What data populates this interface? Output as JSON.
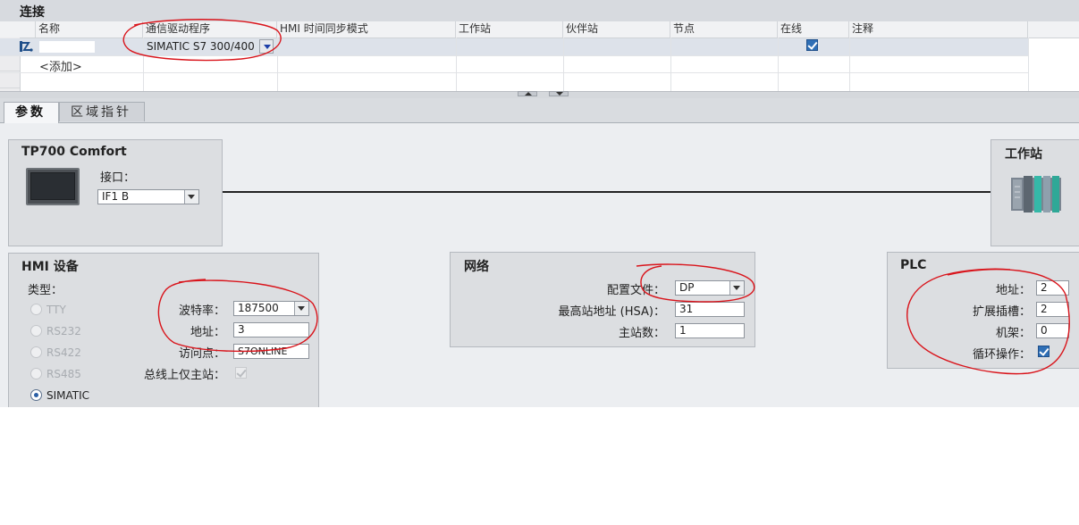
{
  "connections": {
    "title": "连接",
    "columns": [
      "名称",
      "通信驱动程序",
      "HMI 时间同步模式",
      "工作站",
      "伙伴站",
      "节点",
      "在线",
      "注释"
    ],
    "row": {
      "driver": "SIMATIC S7 300/400",
      "online": true
    },
    "add_label": "<添加>"
  },
  "tabs": [
    {
      "label": "参数",
      "active": true
    },
    {
      "label": "区域指针",
      "active": false
    }
  ],
  "device": {
    "title": "TP700 Comfort",
    "interface_label": "接口：",
    "interface_value": "IF1 B"
  },
  "station": {
    "title": "工作站"
  },
  "hmi": {
    "title": "HMI 设备",
    "type_label": "类型：",
    "types": [
      {
        "label": "TTY",
        "selected": false
      },
      {
        "label": "RS232",
        "selected": false
      },
      {
        "label": "RS422",
        "selected": false
      },
      {
        "label": "RS485",
        "selected": false
      },
      {
        "label": "SIMATIC",
        "selected": true
      }
    ],
    "baud_label": "波特率：",
    "baud_value": "187500",
    "address_label": "地址：",
    "address_value": "3",
    "access_label": "访问点：",
    "access_value": "S7ONLINE",
    "only_master_label": "总线上仅主站："
  },
  "network": {
    "title": "网络",
    "profile_label": "配置文件：",
    "profile_value": "DP",
    "hsa_label": "最高站地址 (HSA)：",
    "hsa_value": "31",
    "masters_label": "主站数：",
    "masters_value": "1"
  },
  "plc": {
    "title": "PLC",
    "address_label": "地址：",
    "address_value": "2",
    "slot_label": "扩展插槽：",
    "slot_value": "2",
    "rack_label": "机架：",
    "rack_value": "0",
    "cyclic_label": "循环操作：",
    "cyclic_checked": true
  },
  "colors": {
    "annotation": "#d9141b",
    "checkbox": "#2f6fb6",
    "panel": "#dcdee1"
  },
  "icons": [
    "connection-icon",
    "hmi-panel-icon",
    "plc-station-icon",
    "dropdown-arrow-icon"
  ]
}
